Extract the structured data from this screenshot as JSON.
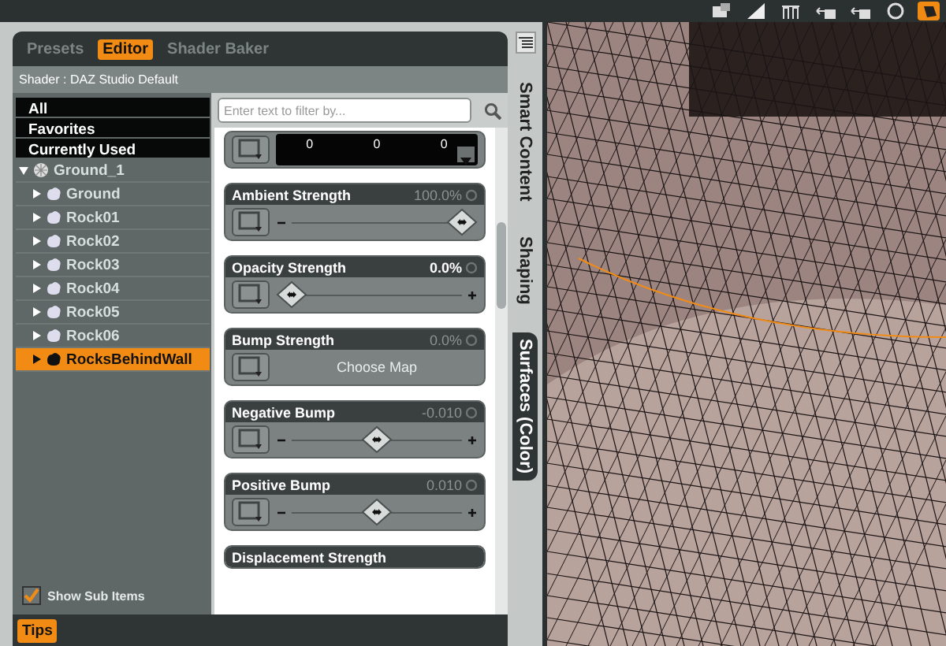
{
  "toolbar": {
    "tools": [
      {
        "selected": false
      },
      {
        "selected": false
      },
      {
        "selected": false
      },
      {
        "selected": false
      },
      {
        "selected": false
      },
      {
        "selected": false
      },
      {
        "selected": true
      }
    ]
  },
  "panel": {
    "tabs": [
      {
        "label": "Presets",
        "selected": false
      },
      {
        "label": "Editor",
        "selected": true
      },
      {
        "label": "Shader Baker",
        "selected": false
      }
    ],
    "shader": "Shader : DAZ Studio Default",
    "filters": [
      {
        "label": "All"
      },
      {
        "label": "Favorites"
      },
      {
        "label": "Currently Used"
      }
    ],
    "tree": [
      {
        "label": "Ground_1",
        "expanded": true,
        "selected": false,
        "children": [
          {
            "label": "Ground",
            "expanded": false,
            "selected": false
          },
          {
            "label": "Rock01",
            "expanded": false,
            "selected": false
          },
          {
            "label": "Rock02",
            "expanded": false,
            "selected": false
          },
          {
            "label": "Rock03",
            "expanded": false,
            "selected": false
          },
          {
            "label": "Rock04",
            "expanded": false,
            "selected": false
          },
          {
            "label": "Rock05",
            "expanded": false,
            "selected": false
          },
          {
            "label": "Rock06",
            "expanded": false,
            "selected": false
          },
          {
            "label": "RocksBehindWall",
            "expanded": false,
            "selected": true
          }
        ]
      }
    ],
    "show_sub_items": {
      "label": "Show Sub Items",
      "checked": true
    },
    "filter_field": {
      "placeholder": "Enter text to filter by..."
    },
    "properties": [
      {
        "kind": "color",
        "values": [
          "0",
          "0",
          "0"
        ]
      },
      {
        "kind": "slider",
        "name": "Ambient Strength",
        "value": "100.0%",
        "modified": false,
        "level": 1
      },
      {
        "kind": "slider",
        "name": "Opacity Strength",
        "value": "0.0%",
        "modified": true,
        "level": 0
      },
      {
        "kind": "map",
        "name": "Bump Strength",
        "value": "0.0%",
        "modified": false,
        "map": "Choose Map"
      },
      {
        "kind": "slider",
        "name": "Negative Bump",
        "value": "-0.010",
        "modified": false,
        "level": 0.5
      },
      {
        "kind": "slider",
        "name": "Positive Bump",
        "value": "0.010",
        "modified": false,
        "level": 0.5
      },
      {
        "kind": "title",
        "name": "Displacement Strength"
      }
    ],
    "tips": {
      "label": "Tips",
      "selected": true
    }
  },
  "side_tabs": [
    {
      "label": "Smart Content",
      "selected": false
    },
    {
      "label": "Shaping",
      "selected": false
    },
    {
      "label": "Surfaces (Color)",
      "selected": true
    }
  ]
}
